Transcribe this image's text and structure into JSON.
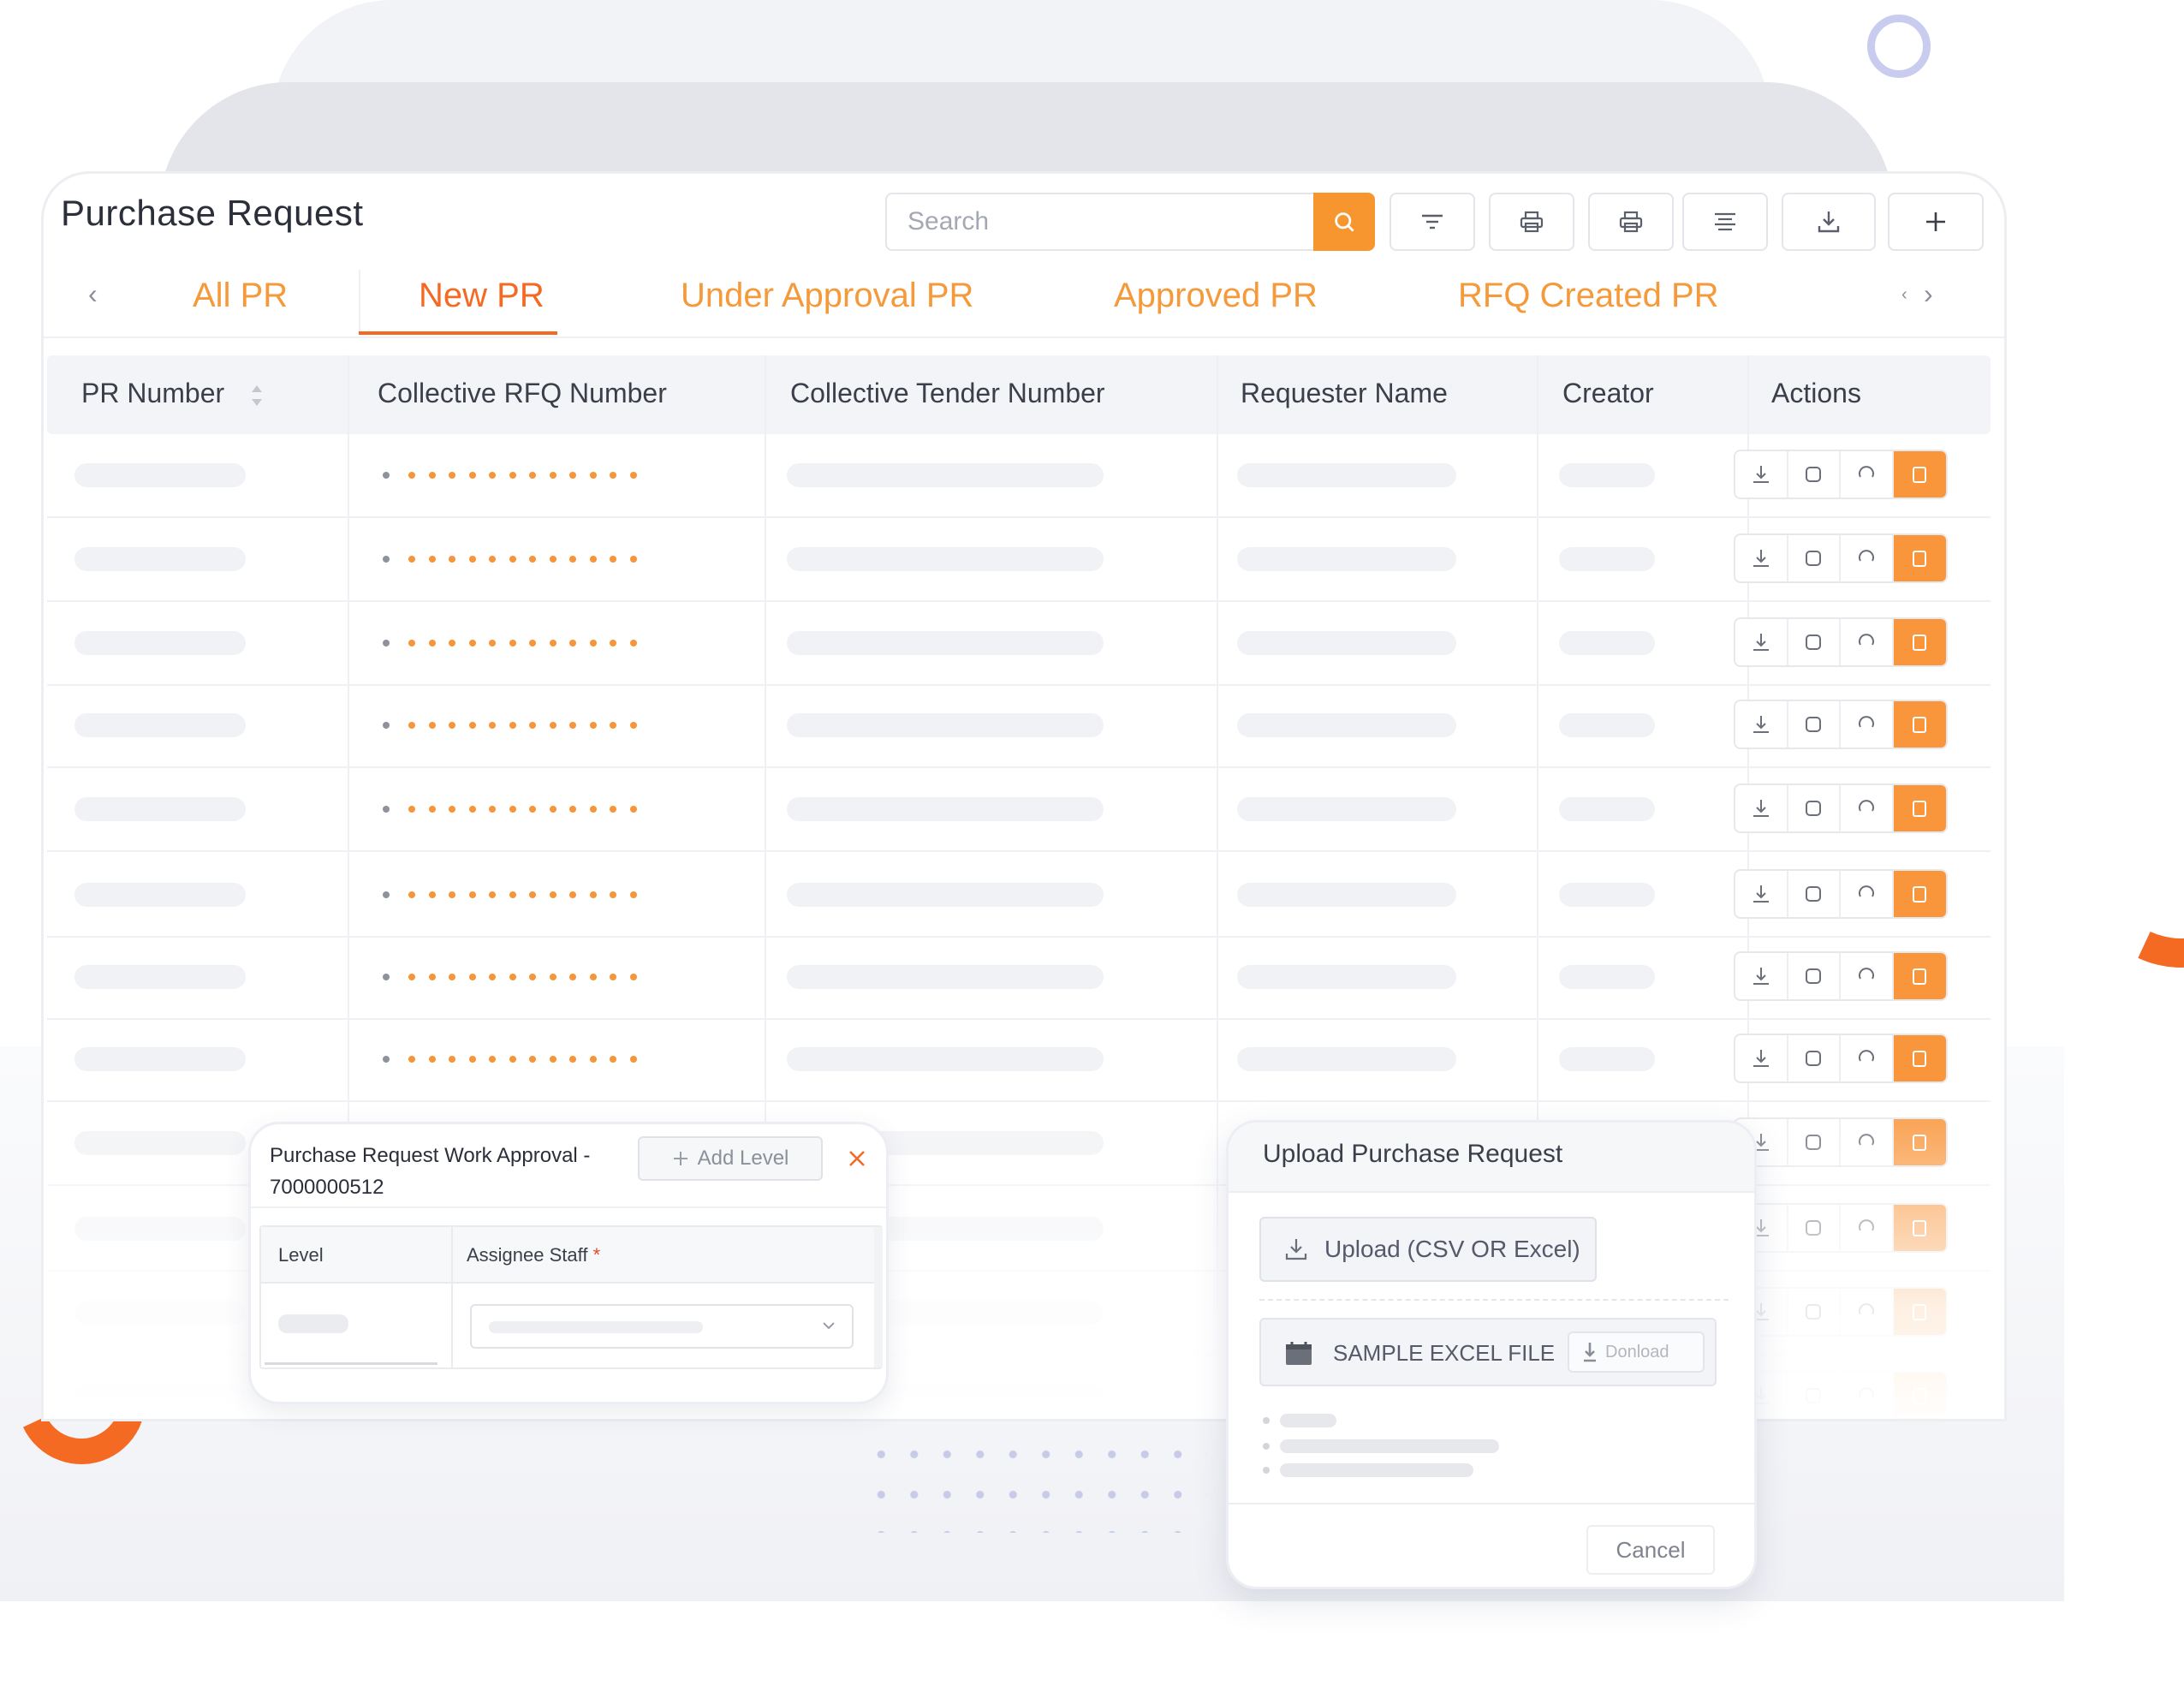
{
  "page": {
    "title": "Purchase Request"
  },
  "toolbar": {
    "search_placeholder": "Search",
    "buttons": [
      "filter-icon",
      "print-icon",
      "print-icon",
      "align-icon",
      "download-icon",
      "plus-icon"
    ]
  },
  "tabs": {
    "items": [
      "All PR",
      "New PR",
      "Under Approval PR",
      "Approved PR",
      "RFQ Created PR"
    ],
    "active": "New PR"
  },
  "table": {
    "columns": [
      "PR Number",
      "Collective RFQ Number",
      "Collective Tender Number",
      "Requester Name",
      "Creator",
      "Actions"
    ],
    "row_actions": [
      "download-icon",
      "view-icon",
      "refresh-icon",
      "delete-icon"
    ]
  },
  "approval_modal": {
    "title": "Purchase Request Work Approval - 7000000512",
    "add_level_label": "Add Level",
    "col_level": "Level",
    "col_assignee": "Assignee Staff",
    "required_mark": "*"
  },
  "upload_modal": {
    "title": "Upload Purchase Request",
    "upload_button": "Upload (CSV OR Excel)",
    "sample_label": "SAMPLE EXCEL FILE",
    "download_label": "Donload",
    "cancel_label": "Cancel"
  },
  "colors": {
    "accent": "#f46a22",
    "accent_light": "#f7962e",
    "ring": "#c9ccef"
  }
}
